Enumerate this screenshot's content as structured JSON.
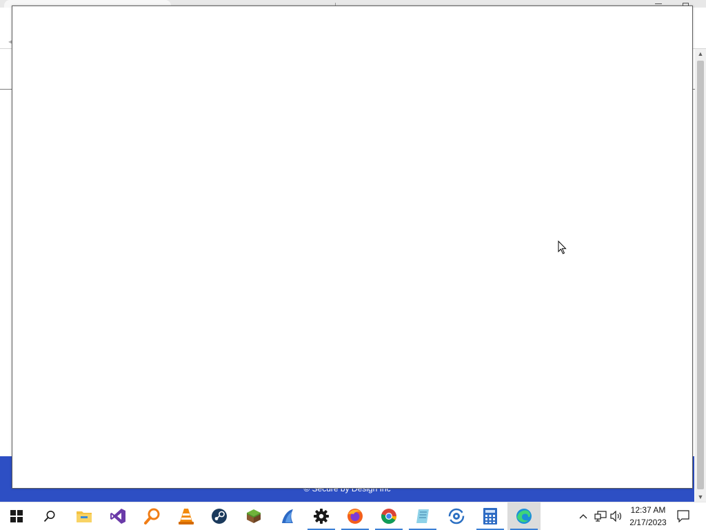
{
  "background_page": {
    "footer_text": "© Secure by Design Inc"
  },
  "taskbar": {
    "apps": [
      {
        "name": "Start",
        "icon": "windows-logo-icon"
      },
      {
        "name": "Search",
        "icon": "search-icon"
      },
      {
        "name": "File Explorer",
        "icon": "folder-icon"
      },
      {
        "name": "Visual Studio",
        "icon": "visual-studio-icon"
      },
      {
        "name": "Search Tool",
        "icon": "magnifier-orange-icon"
      },
      {
        "name": "VLC media player",
        "icon": "vlc-cone-icon"
      },
      {
        "name": "Steam",
        "icon": "steam-icon"
      },
      {
        "name": "Minecraft",
        "icon": "grass-block-icon"
      },
      {
        "name": "App",
        "icon": "blue-bird-icon"
      },
      {
        "name": "Settings",
        "icon": "gear-icon"
      },
      {
        "name": "Firefox",
        "icon": "firefox-icon"
      },
      {
        "name": "Google Chrome",
        "icon": "chrome-icon"
      },
      {
        "name": "Notepad",
        "icon": "notepad-icon"
      },
      {
        "name": "App",
        "icon": "sync-circle-icon"
      },
      {
        "name": "Calculator",
        "icon": "calculator-icon"
      },
      {
        "name": "Microsoft Edge",
        "icon": "edge-icon"
      }
    ],
    "clock": {
      "time": "12:37 AM",
      "date": "2/17/2023"
    },
    "tray_icons": [
      "chevron-up-icon",
      "network-icon",
      "volume-icon",
      "notification-icon"
    ]
  },
  "colors": {
    "footer_bg": "#2d4fc4",
    "taskbar_bg": "#ffffff",
    "running_indicator": "#3a7fd5"
  }
}
